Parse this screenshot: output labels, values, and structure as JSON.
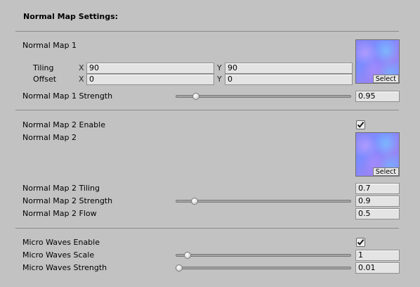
{
  "title": "Normal Map Settings:",
  "section1": {
    "normal_map_1_label": "Normal Map 1",
    "tiling_label": "Tiling",
    "offset_label": "Offset",
    "axis_x": "X",
    "axis_y": "Y",
    "tiling_x": "90",
    "tiling_y": "90",
    "offset_x": "0",
    "offset_y": "0",
    "texture_select_label": "Select",
    "strength_label": "Normal Map 1 Strength",
    "strength_value": "0.95",
    "strength_slider_fraction": 0.1
  },
  "section2": {
    "enable_label": "Normal Map 2 Enable",
    "enable_checked": true,
    "normal_map_2_label": "Normal Map 2",
    "texture_select_label": "Select",
    "tiling_label": "Normal Map 2 Tiling",
    "tiling_value": "0.7",
    "strength_label": "Normal Map 2 Strength",
    "strength_value": "0.9",
    "strength_slider_fraction": 0.09,
    "flow_label": "Normal Map 2 Flow",
    "flow_value": "0.5"
  },
  "section3": {
    "enable_label": "Micro Waves Enable",
    "enable_checked": true,
    "scale_label": "Micro Waves Scale",
    "scale_value": "1",
    "scale_slider_fraction": 0.05,
    "strength_label": "Micro Waves Strength",
    "strength_value": "0.01",
    "strength_slider_fraction": 0.0
  }
}
